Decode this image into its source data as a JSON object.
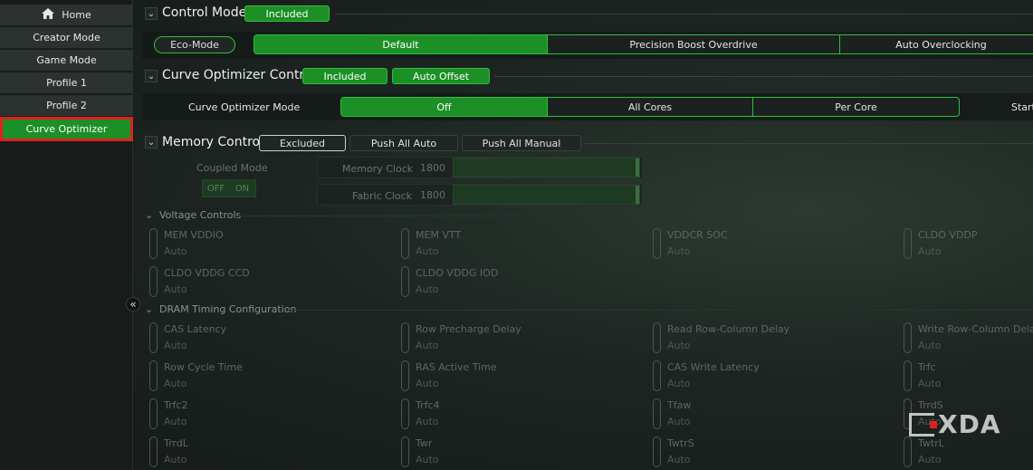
{
  "sidebar": {
    "items": [
      {
        "label": "Home",
        "icon": "home-icon"
      },
      {
        "label": "Creator Mode"
      },
      {
        "label": "Game Mode"
      },
      {
        "label": "Profile 1"
      },
      {
        "label": "Profile 2"
      },
      {
        "label": "Curve Optimizer",
        "active": true
      }
    ],
    "collapse_glyph": "«"
  },
  "control_mode": {
    "title": "Control Mode",
    "badge": "Included",
    "eco": "Eco-Mode",
    "options": [
      "Default",
      "Precision Boost Overdrive",
      "Auto Overclocking"
    ],
    "selected": "Default"
  },
  "curve_optimizer": {
    "title": "Curve Optimizer Control",
    "badge1": "Included",
    "badge2": "Auto Offset",
    "mode_label": "Curve Optimizer Mode",
    "options": [
      "Off",
      "All Cores",
      "Per Core"
    ],
    "selected": "Off",
    "trailing": "Start"
  },
  "memory": {
    "title": "Memory Control",
    "tabs": [
      "Excluded",
      "Push All Auto",
      "Push All Manual"
    ],
    "coupled_label": "Coupled Mode",
    "off": "OFF",
    "on": "ON",
    "memory_clock_label": "Memory Clock",
    "memory_clock": "1800",
    "fabric_clock_label": "Fabric Clock",
    "fabric_clock": "1800"
  },
  "voltage": {
    "title": "Voltage Controls",
    "items": [
      {
        "name": "MEM VDDIO",
        "value": "Auto"
      },
      {
        "name": "MEM VTT",
        "value": "Auto"
      },
      {
        "name": "VDDCR SOC",
        "value": "Auto"
      },
      {
        "name": "CLDO VDDP",
        "value": "Auto"
      },
      {
        "name": "CLDO VDDG CCD",
        "value": "Auto"
      },
      {
        "name": "CLDO VDDG IOD",
        "value": "Auto"
      }
    ]
  },
  "dram": {
    "title": "DRAM Timing Configuration",
    "items": [
      {
        "name": "CAS Latency",
        "value": "Auto"
      },
      {
        "name": "Row Precharge Delay",
        "value": "Auto"
      },
      {
        "name": "Read Row-Column Delay",
        "value": "Auto"
      },
      {
        "name": "Write Row-Column Delay",
        "value": "Auto"
      },
      {
        "name": "Row Cycle Time",
        "value": "Auto"
      },
      {
        "name": "RAS Active Time",
        "value": "Auto"
      },
      {
        "name": "CAS Write Latency",
        "value": "Auto"
      },
      {
        "name": "Trfc",
        "value": "Auto"
      },
      {
        "name": "Trfc2",
        "value": "Auto"
      },
      {
        "name": "Trfc4",
        "value": "Auto"
      },
      {
        "name": "Tfaw",
        "value": "Auto"
      },
      {
        "name": "TrrdS",
        "value": "Auto"
      },
      {
        "name": "TrrdL",
        "value": "Auto"
      },
      {
        "name": "Twr",
        "value": "Auto"
      },
      {
        "name": "TwtrS",
        "value": "Auto"
      },
      {
        "name": "TwtrL",
        "value": "Auto"
      }
    ]
  },
  "watermark": "XDA",
  "colors": {
    "accent": "#1d8f27",
    "accent_border": "#2fbf3a",
    "highlight": "#e02020"
  }
}
